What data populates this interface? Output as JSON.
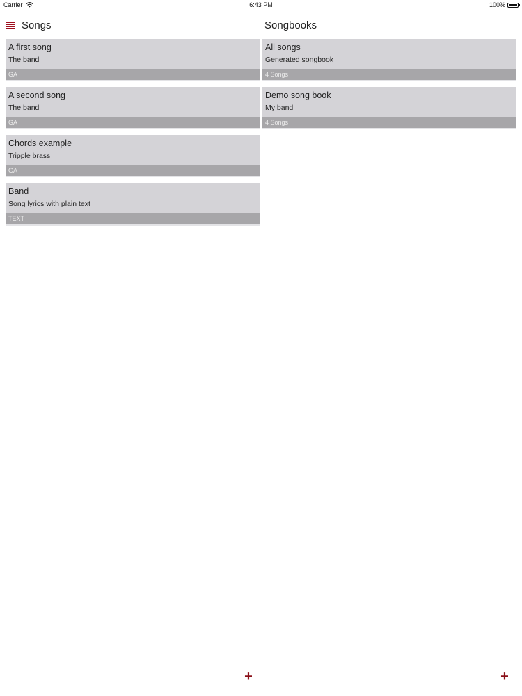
{
  "status_bar": {
    "carrier": "Carrier",
    "time": "6:43 PM",
    "battery": "100%"
  },
  "songs": {
    "title": "Songs",
    "items": [
      {
        "title": "A first song",
        "subtitle": "The band",
        "footer": "GA"
      },
      {
        "title": "A second song",
        "subtitle": "The band",
        "footer": "GA"
      },
      {
        "title": "Chords example",
        "subtitle": "Tripple brass",
        "footer": "GA"
      },
      {
        "title": "Band",
        "subtitle": "Song lyrics with plain text",
        "footer": "TEXT"
      }
    ],
    "add_label": "+"
  },
  "songbooks": {
    "title": "Songbooks",
    "items": [
      {
        "title": "All songs",
        "subtitle": "Generated songbook",
        "footer": "4 Songs"
      },
      {
        "title": "Demo song book",
        "subtitle": "My band",
        "footer": "4 Songs"
      }
    ],
    "add_label": "+"
  },
  "colors": {
    "accent": "#a01020",
    "card_bg": "#d4d3d7",
    "card_footer_bg": "#a7a6a9"
  }
}
